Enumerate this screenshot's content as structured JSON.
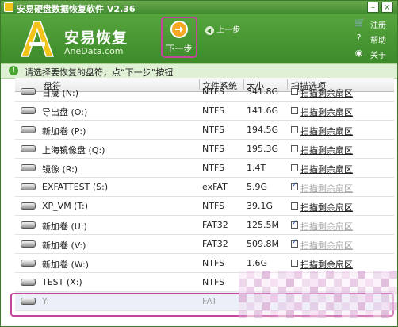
{
  "window": {
    "title": "安易硬盘数据恢复软件 V2.36"
  },
  "logo": {
    "name": "安易恢复",
    "url": "AneData.com"
  },
  "toolbar": {
    "next_label": "下一步",
    "prev_label": "上一步"
  },
  "side_menu": [
    {
      "label": "注册",
      "icon": "cart-icon"
    },
    {
      "label": "帮助",
      "icon": "help-icon"
    },
    {
      "label": "关于",
      "icon": "about-icon"
    }
  ],
  "hint": {
    "text": "请选择要恢复的盘符，点“下一步”按钮"
  },
  "columns": {
    "drive": "盘符",
    "fs": "文件系统",
    "size": "大小",
    "scan": "扫描选项"
  },
  "rows": [
    {
      "name": "日晟 (N:)",
      "fs": "NTFS",
      "size": "341.8G",
      "scan": "扫描剩余扇区",
      "checked": false,
      "disabled": false
    },
    {
      "name": "导出盘 (O:)",
      "fs": "NTFS",
      "size": "141.6G",
      "scan": "扫描剩余扇区",
      "checked": false,
      "disabled": false
    },
    {
      "name": "新加卷 (P:)",
      "fs": "NTFS",
      "size": "194.5G",
      "scan": "扫描剩余扇区",
      "checked": false,
      "disabled": false
    },
    {
      "name": "上海镜像盘 (Q:)",
      "fs": "NTFS",
      "size": "195.3G",
      "scan": "扫描剩余扇区",
      "checked": false,
      "disabled": false
    },
    {
      "name": "镜像 (R:)",
      "fs": "NTFS",
      "size": "1.4T",
      "scan": "扫描剩余扇区",
      "checked": false,
      "disabled": false
    },
    {
      "name": "EXFATTEST (S:)",
      "fs": "exFAT",
      "size": "5.9G",
      "scan": "扫描剩余扇区",
      "checked": true,
      "disabled": true
    },
    {
      "name": "XP_VM (T:)",
      "fs": "NTFS",
      "size": "39.1G",
      "scan": "扫描剩余扇区",
      "checked": false,
      "disabled": false
    },
    {
      "name": "新加卷 (U:)",
      "fs": "FAT32",
      "size": "125.5M",
      "scan": "扫描剩余扇区",
      "checked": true,
      "disabled": true
    },
    {
      "name": "新加卷 (V:)",
      "fs": "FAT32",
      "size": "509.8M",
      "scan": "扫描剩余扇区",
      "checked": true,
      "disabled": true
    },
    {
      "name": "新加卷 (W:)",
      "fs": "NTFS",
      "size": "1.6G",
      "scan": "扫描剩余扇区",
      "checked": false,
      "disabled": false
    },
    {
      "name": "TEST (X:)",
      "fs": "NTFS",
      "size": "",
      "scan": "",
      "checked": false,
      "disabled": false
    },
    {
      "name": "Y:",
      "fs": "FAT",
      "size": "",
      "scan": "",
      "checked": false,
      "disabled": false,
      "selected": true
    }
  ],
  "colors": {
    "brand_green": "#3f8a2f",
    "highlight_pink": "#c2469c"
  }
}
